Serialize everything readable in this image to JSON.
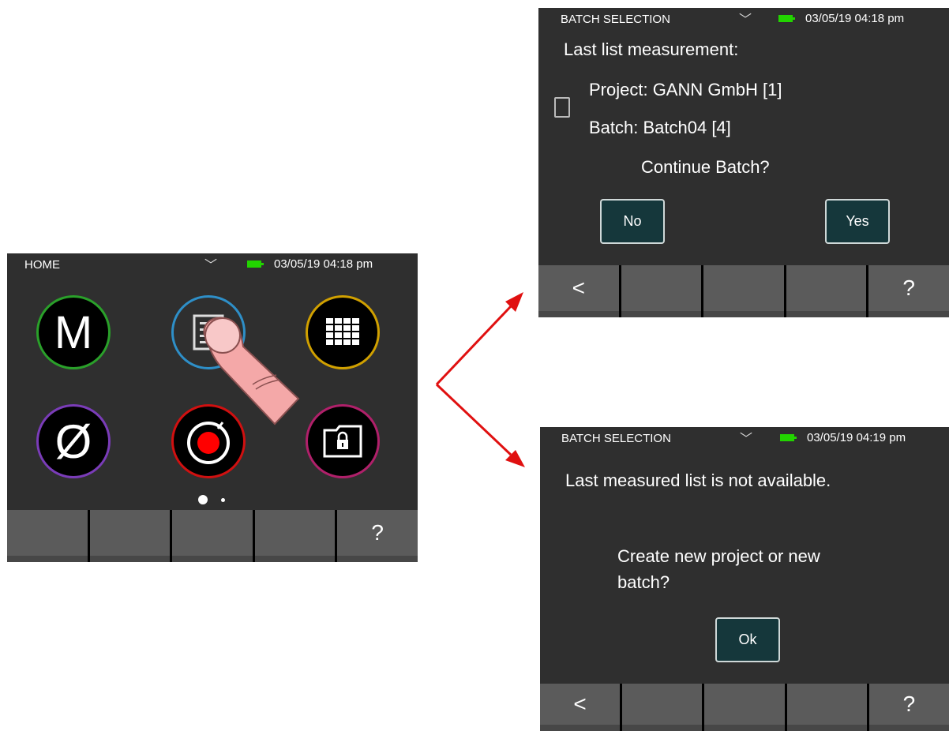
{
  "home": {
    "title": "HOME",
    "datetime": "03/05/19 04:18 pm",
    "icons": [
      {
        "label": "M",
        "ring": "#2aa02a"
      },
      {
        "label": "",
        "ring": "#2e8fc8"
      },
      {
        "label": "",
        "ring": "#d0a000"
      },
      {
        "label": "Ø",
        "ring": "#7a3cb8"
      },
      {
        "label": "",
        "ring": "#d01010"
      },
      {
        "label": "",
        "ring": "#b0206a"
      }
    ],
    "help": "?"
  },
  "batch_continue": {
    "title": "BATCH SELECTION",
    "datetime": "03/05/19 04:18 pm",
    "heading": "Last list measurement:",
    "project": "Project: GANN GmbH [1]",
    "batch": "Batch: Batch04 [4]",
    "question": "Continue Batch?",
    "no": "No",
    "yes": "Yes",
    "back": "<",
    "help": "?"
  },
  "batch_unavailable": {
    "title": "BATCH SELECTION",
    "datetime": "03/05/19 04:19 pm",
    "message": "Last measured list is not available.",
    "prompt_line1": "Create new project or new",
    "prompt_line2": "batch?",
    "ok": "Ok",
    "back": "<",
    "help": "?"
  },
  "colors": {
    "battery": "#22d400",
    "arrow": "#e01010",
    "button_bg": "#15373b"
  }
}
